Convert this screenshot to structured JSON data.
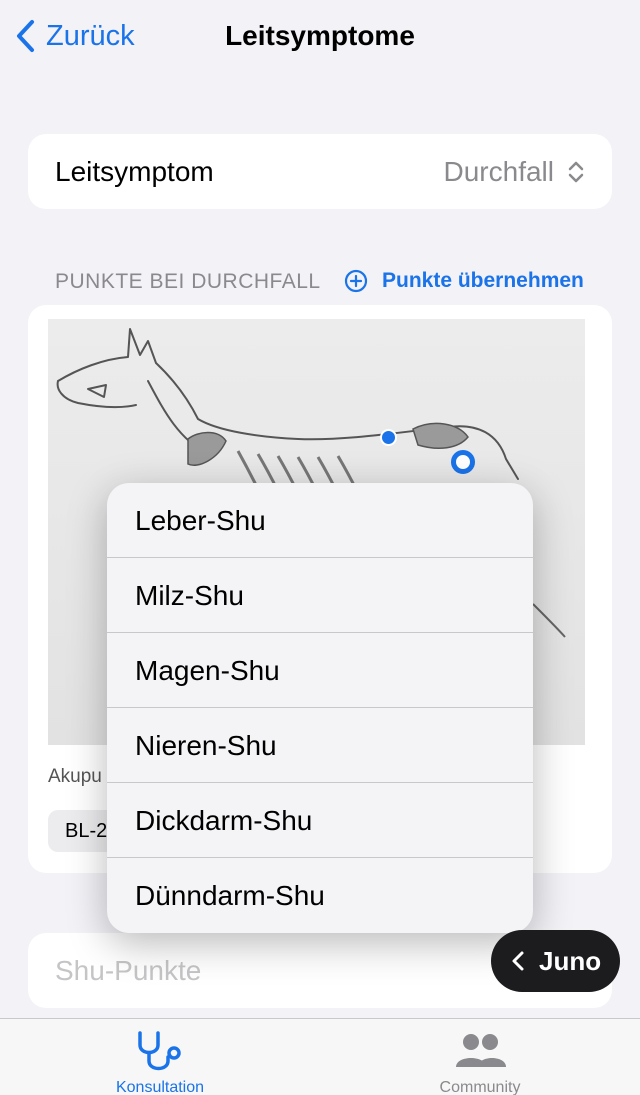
{
  "nav": {
    "back_label": "Zurück",
    "title": "Leitsymptome"
  },
  "picker": {
    "label": "Leitsymptom",
    "value": "Durchfall"
  },
  "section": {
    "header": "PUNKTE BEI DURCHFALL",
    "action_label": "Punkte übernehmen"
  },
  "image_card": {
    "caption": "Akupu",
    "chip_label": "BL-2"
  },
  "menu": {
    "items": [
      "Leber-Shu",
      "Milz-Shu",
      "Magen-Shu",
      "Nieren-Shu",
      "Dickdarm-Shu",
      "Dünndarm-Shu"
    ]
  },
  "shu_field": {
    "placeholder": "Shu-Punkte"
  },
  "juno": {
    "label": "Juno"
  },
  "tabbar": {
    "tabs": [
      {
        "label": "Konsultation",
        "icon": "stethoscope-icon"
      },
      {
        "label": "Community",
        "icon": "people-icon"
      }
    ]
  },
  "colors": {
    "accent": "#1a73e8",
    "background": "#f2f2f7",
    "juno_bg": "#1c1c1e"
  }
}
